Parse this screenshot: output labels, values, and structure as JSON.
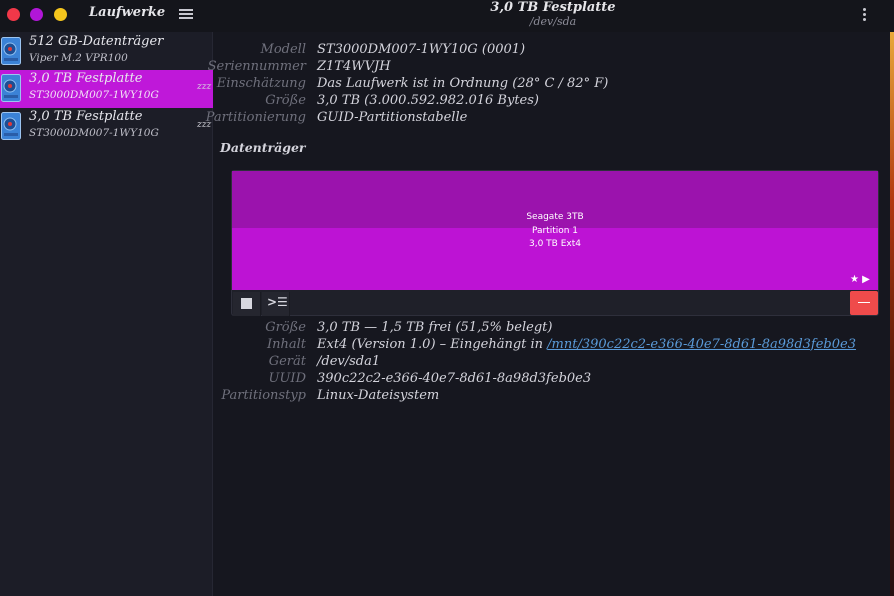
{
  "window": {
    "sidebar_title": "Laufwerke",
    "main_title": "3,0 TB Festplatte",
    "main_subtitle": "/dev/sda"
  },
  "sidebar": {
    "drives": [
      {
        "name": "512 GB-Datenträger",
        "model": "Viper M.2 VPR100",
        "selected": false,
        "sleeping": false
      },
      {
        "name": "3,0 TB Festplatte",
        "model": "ST3000DM007-1WY10G",
        "selected": true,
        "sleeping": true
      },
      {
        "name": "3,0 TB Festplatte",
        "model": "ST3000DM007-1WY10G",
        "selected": false,
        "sleeping": true
      }
    ],
    "sleep_glyph": "zzz"
  },
  "drive_info": [
    {
      "label": "Modell",
      "value": "ST3000DM007-1WY10G (0001)"
    },
    {
      "label": "Seriennummer",
      "value": "Z1T4WVJH"
    },
    {
      "label": "Einschätzung",
      "value": "Das Laufwerk ist in Ordnung (28° C / 82° F)"
    },
    {
      "label": "Größe",
      "value": "3,0 TB (3.000.592.982.016 Bytes)"
    },
    {
      "label": "Partitionierung",
      "value": "GUID-Partitionstabelle"
    }
  ],
  "volumes": {
    "section_title": "Datenträger",
    "partition": {
      "line1": "Seagate 3TB",
      "line2": "Partition 1",
      "line3": "3,0 TB Ext4",
      "icons": "★ ▶",
      "color": "#bd13d4"
    },
    "toolbar": {
      "more_glyph": ">☰"
    }
  },
  "volume_info": {
    "size_label": "Größe",
    "size_value": "3,0 TB — 1,5 TB frei (51,5% belegt)",
    "content_label": "Inhalt",
    "content_prefix": "Ext4 (Version 1.0) – Eingehängt in ",
    "content_link": "/mnt/390c22c2-e366-40e7-8d61-8a98d3feb0e3",
    "device_label": "Gerät",
    "device_value": "/dev/sda1",
    "uuid_label": "UUID",
    "uuid_value": "390c22c2-e366-40e7-8d61-8a98d3feb0e3",
    "ptype_label": "Partitionstyp",
    "ptype_value": "Linux-Dateisystem"
  },
  "colors": {
    "accent": "#bf18d9",
    "close": "#f13849",
    "minimize": "#b116d8",
    "maximize": "#f4c51d",
    "delete": "#ef4b4b",
    "link": "#5a9ad8"
  }
}
